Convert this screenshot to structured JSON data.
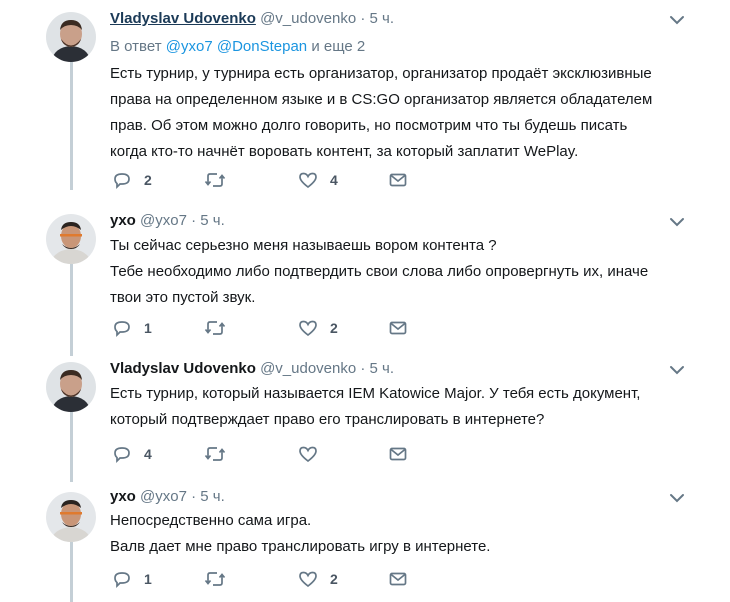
{
  "tweets": [
    {
      "name": "Vladyslav Udovenko",
      "handle": "@v_udovenko",
      "dot": "·",
      "time": "5 ч.",
      "reply_prefix": "В ответ",
      "reply_user1": "@yxo7",
      "reply_user2": "@DonStepan",
      "reply_suffix": "и еще 2",
      "lines": [
        "Есть турнир, у турнира есть организатор, организатор продаёт эксклюзивные",
        "права на определенном языке и в CS:GO организатор является обладателем",
        "прав. Об этом можно долго говорить, но посмотрим что ты будешь писать",
        "когда кто-то начнёт воровать контент, за который заплатит WePlay."
      ],
      "replies": "2",
      "retweets": "",
      "likes": "4"
    },
    {
      "name": "yxo",
      "handle": "@yxo7",
      "dot": "·",
      "time": "5 ч.",
      "lines": [
        "Ты сейчас серьезно меня называешь вором контента ?",
        "Тебе необходимо либо подтвердить свои слова либо опровергнуть их, иначе",
        "твои это пустой звук."
      ],
      "replies": "1",
      "retweets": "",
      "likes": "2"
    },
    {
      "name": "Vladyslav Udovenko",
      "handle": "@v_udovenko",
      "dot": "·",
      "time": "5 ч.",
      "lines": [
        "Есть турнир, который называется IEM Katowice Major. У тебя есть документ,",
        "который подтверждает право его транслировать в интернете?"
      ],
      "replies": "4",
      "retweets": "",
      "likes": ""
    },
    {
      "name": "yxo",
      "handle": "@yxo7",
      "dot": "·",
      "time": "5 ч.",
      "lines": [
        "Непосредственно сама игра.",
        "Валв дает мне право транслировать игру в интернете."
      ],
      "replies": "1",
      "retweets": "",
      "likes": "2"
    }
  ],
  "icons": {
    "reply": "reply-icon",
    "retweet": "retweet-icon",
    "like": "heart-icon",
    "dm": "envelope-icon",
    "caret": "chevron-down-icon"
  },
  "colors": {
    "link": "#1b95e0",
    "meta": "#657786",
    "thread_line": "#c4cfd6"
  }
}
